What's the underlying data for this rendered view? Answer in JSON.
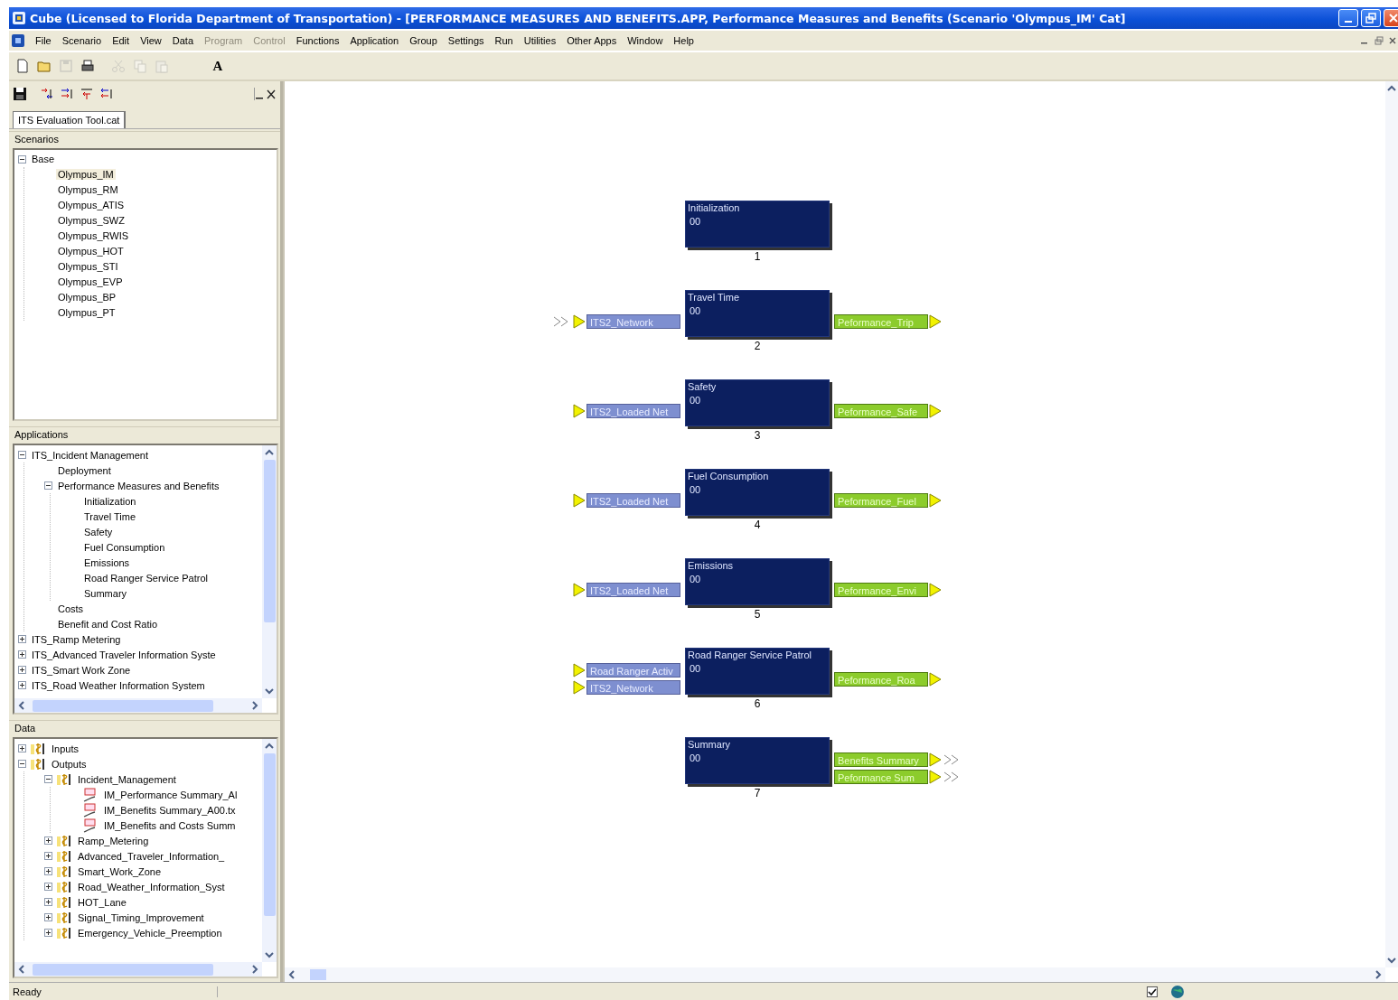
{
  "window": {
    "title": "Cube (Licensed to Florida Department of Transportation) - [PERFORMANCE MEASURES AND BENEFITS.APP, Performance Measures and Benefits (Scenario 'Olympus_IM' Cat]"
  },
  "menu": [
    {
      "label": "File",
      "disabled": false
    },
    {
      "label": "Scenario",
      "disabled": false
    },
    {
      "label": "Edit",
      "disabled": false
    },
    {
      "label": "View",
      "disabled": false
    },
    {
      "label": "Data",
      "disabled": false
    },
    {
      "label": "Program",
      "disabled": true
    },
    {
      "label": "Control",
      "disabled": true
    },
    {
      "label": "Functions",
      "disabled": false
    },
    {
      "label": "Application",
      "disabled": false
    },
    {
      "label": "Group",
      "disabled": false
    },
    {
      "label": "Settings",
      "disabled": false
    },
    {
      "label": "Run",
      "disabled": false
    },
    {
      "label": "Utilities",
      "disabled": false
    },
    {
      "label": "Other Apps",
      "disabled": false
    },
    {
      "label": "Window",
      "disabled": false
    },
    {
      "label": "Help",
      "disabled": false
    }
  ],
  "toolbar": [
    {
      "kind": "new",
      "disabled": false
    },
    {
      "kind": "open",
      "disabled": false
    },
    {
      "kind": "save",
      "disabled": true
    },
    {
      "kind": "print",
      "disabled": false
    },
    {
      "kind": "cut",
      "disabled": true
    },
    {
      "kind": "copy",
      "disabled": true
    },
    {
      "kind": "paste",
      "disabled": true
    },
    {
      "kind": "font",
      "label": "A",
      "disabled": false
    }
  ],
  "panel": {
    "tabs": [
      {
        "label": "ITS Evaluation Tool.cat",
        "selected": true
      }
    ],
    "scenarios": {
      "header": "Scenarios",
      "tree": [
        {
          "label": "Base",
          "selected": false,
          "expanded": true,
          "children": [
            {
              "label": "Olympus_IM",
              "selected": true
            },
            {
              "label": "Olympus_RM",
              "selected": false
            },
            {
              "label": "Olympus_ATIS",
              "selected": false
            },
            {
              "label": "Olympus_SWZ",
              "selected": false
            },
            {
              "label": "Olympus_RWIS",
              "selected": false
            },
            {
              "label": "Olympus_HOT",
              "selected": false
            },
            {
              "label": "Olympus_STI",
              "selected": false
            },
            {
              "label": "Olympus_EVP",
              "selected": false
            },
            {
              "label": "Olympus_BP",
              "selected": false
            },
            {
              "label": "Olympus_PT",
              "selected": false
            }
          ]
        }
      ]
    },
    "applications": {
      "header": "Applications",
      "tree": [
        {
          "label": "ITS_Incident Management",
          "expanded": true,
          "children": [
            {
              "label": "Deployment"
            },
            {
              "label": "Performance Measures and Benefits",
              "expanded": true,
              "children": [
                {
                  "label": "Initialization"
                },
                {
                  "label": "Travel Time"
                },
                {
                  "label": "Safety"
                },
                {
                  "label": "Fuel Consumption"
                },
                {
                  "label": "Emissions"
                },
                {
                  "label": "Road Ranger Service Patrol"
                },
                {
                  "label": "Summary"
                }
              ]
            },
            {
              "label": "Costs"
            },
            {
              "label": "Benefit and Cost Ratio"
            }
          ]
        },
        {
          "label": "ITS_Ramp Metering",
          "expanded": false
        },
        {
          "label": "ITS_Advanced Traveler Information Syste",
          "expanded": false
        },
        {
          "label": "ITS_Smart Work Zone",
          "expanded": false
        },
        {
          "label": "ITS_Road Weather Information System",
          "expanded": false
        }
      ]
    },
    "data": {
      "header": "Data",
      "tree": [
        {
          "label": "Inputs",
          "kind": "folder",
          "expanded": false
        },
        {
          "label": "Outputs",
          "kind": "folder",
          "expanded": true,
          "children": [
            {
              "label": "Incident_Management",
              "kind": "folder",
              "expanded": true,
              "children": [
                {
                  "label": "IM_Performance Summary_Al",
                  "kind": "file"
                },
                {
                  "label": "IM_Benefits Summary_A00.tx",
                  "kind": "file"
                },
                {
                  "label": "IM_Benefits and Costs Summ",
                  "kind": "file"
                }
              ]
            },
            {
              "label": "Ramp_Metering",
              "kind": "folder",
              "expanded": false
            },
            {
              "label": "Advanced_Traveler_Information_",
              "kind": "folder",
              "expanded": false
            },
            {
              "label": "Smart_Work_Zone",
              "kind": "folder",
              "expanded": false
            },
            {
              "label": "Road_Weather_Information_Syst",
              "kind": "folder",
              "expanded": false
            },
            {
              "label": "HOT_Lane",
              "kind": "folder",
              "expanded": false
            },
            {
              "label": "Signal_Timing_Improvement",
              "kind": "folder",
              "expanded": false
            },
            {
              "label": "Emergency_Vehicle_Preemption",
              "kind": "folder",
              "expanded": false
            }
          ]
        }
      ]
    }
  },
  "canvas": {
    "nodes": [
      {
        "title": "Initialization",
        "code": "00",
        "number": "1"
      },
      {
        "title": "Travel Time",
        "code": "00",
        "number": "2",
        "inputs": [
          {
            "label": "ITS2_Network",
            "linked": true
          }
        ],
        "outputs": [
          {
            "label": "Peformance_Trip",
            "linked": false
          }
        ]
      },
      {
        "title": "Safety",
        "code": "00",
        "number": "3",
        "inputs": [
          {
            "label": "ITS2_Loaded Net",
            "linked": false
          }
        ],
        "outputs": [
          {
            "label": "Peformance_Safe",
            "linked": false
          }
        ]
      },
      {
        "title": "Fuel Consumption",
        "code": "00",
        "number": "4",
        "inputs": [
          {
            "label": "ITS2_Loaded Net",
            "linked": false
          }
        ],
        "outputs": [
          {
            "label": "Peformance_Fuel",
            "linked": false
          }
        ]
      },
      {
        "title": "Emissions",
        "code": "00",
        "number": "5",
        "inputs": [
          {
            "label": "ITS2_Loaded Net",
            "linked": false
          }
        ],
        "outputs": [
          {
            "label": "Peformance_Envi",
            "linked": false
          }
        ]
      },
      {
        "title": "Road Ranger Service Patrol",
        "code": "00",
        "number": "6",
        "inputs": [
          {
            "label": "Road Ranger Activ",
            "linked": false
          },
          {
            "label": "ITS2_Network",
            "linked": false
          }
        ],
        "outputs": [
          {
            "label": "Peformance_Roa",
            "linked": false
          }
        ]
      },
      {
        "title": "Summary",
        "code": "00",
        "number": "7",
        "outputs": [
          {
            "label": "Benefits Summary",
            "linked": true
          },
          {
            "label": "Peformance Sum",
            "linked": true
          }
        ]
      }
    ]
  },
  "status_bar": {
    "text": "Ready",
    "checkbox_checked": true
  }
}
